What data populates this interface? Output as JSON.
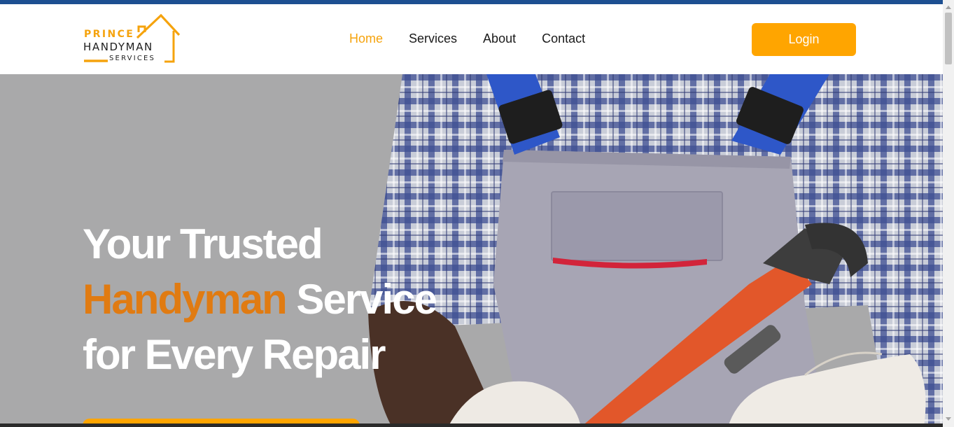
{
  "logo": {
    "line1": "PRINCE",
    "line2": "HANDYMAN",
    "line3": "SERVICES",
    "icon": "house-outline-icon",
    "color": "#f5a30d"
  },
  "nav": {
    "items": [
      {
        "label": "Home",
        "active": true
      },
      {
        "label": "Services",
        "active": false
      },
      {
        "label": "About",
        "active": false
      },
      {
        "label": "Contact",
        "active": false
      }
    ]
  },
  "header": {
    "login_label": "Login"
  },
  "hero": {
    "title_line1": "Your Trusted",
    "title_accent": "Handyman",
    "title_line2_rest": " Service",
    "title_line3": "for Every Repair",
    "background_image": "handyman-in-overalls-holding-pipe-wrench"
  },
  "colors": {
    "accent_orange": "#ffa500",
    "title_accent": "#e07b12",
    "top_strip": "#1d4f91",
    "hero_bg": "#a9a9aa"
  }
}
